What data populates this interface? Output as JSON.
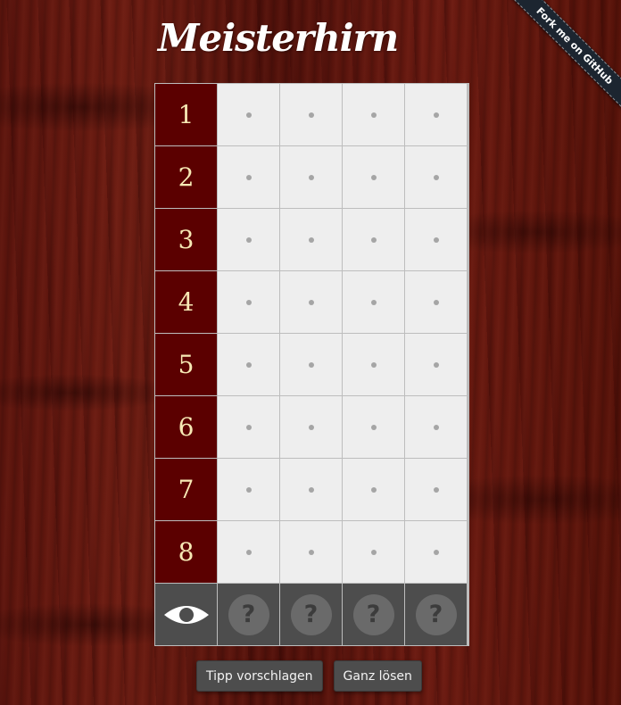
{
  "app": {
    "title": "Meisterhirn",
    "github_ribbon": "Fork me on GitHub"
  },
  "board": {
    "rows": [
      {
        "label": "1"
      },
      {
        "label": "2"
      },
      {
        "label": "3"
      },
      {
        "label": "4"
      },
      {
        "label": "5"
      },
      {
        "label": "6"
      },
      {
        "label": "7"
      },
      {
        "label": "8"
      }
    ],
    "pegs_per_row": 4,
    "secret": {
      "reveal_icon": "eye-icon",
      "slots": [
        "?",
        "?",
        "?",
        "?"
      ]
    }
  },
  "actions": {
    "suggest_label": "Tipp vorschlagen",
    "solve_label": "Ganz lösen"
  },
  "colors": {
    "row_number_bg": "#5b0000",
    "row_number_text": "#f7e9b5",
    "cell_bg": "#eeeeee",
    "secret_bg": "#4d4d4d",
    "ribbon_bg": "#1c2530"
  }
}
